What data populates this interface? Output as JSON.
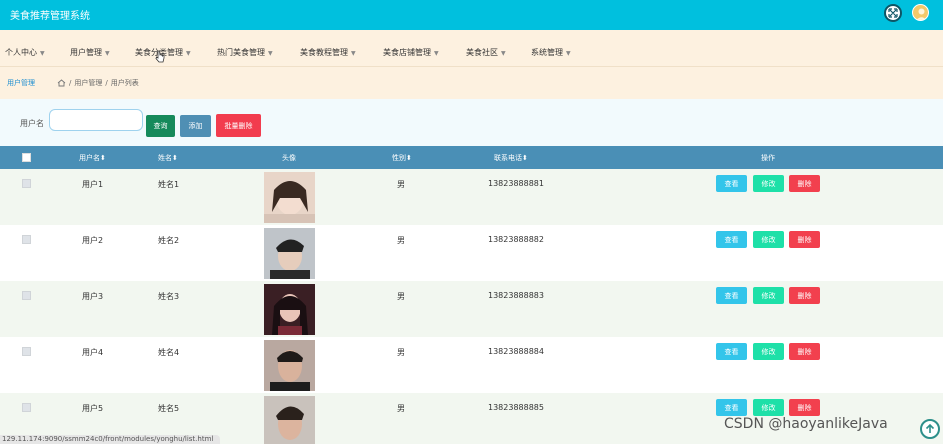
{
  "app": {
    "title": "美食推荐管理系统"
  },
  "header": {
    "fullscreen_icon": "expand-icon",
    "avatar_icon": "user-avatar-icon"
  },
  "menu": [
    {
      "label": "个人中心"
    },
    {
      "label": "用户管理"
    },
    {
      "label": "美食分类管理"
    },
    {
      "label": "热门美食管理"
    },
    {
      "label": "美食教程管理"
    },
    {
      "label": "美食店铺管理"
    },
    {
      "label": "美食社区"
    },
    {
      "label": "系统管理"
    }
  ],
  "breadcrumb": {
    "title": "用户管理",
    "trail": [
      "用户管理",
      "用户列表"
    ]
  },
  "search": {
    "label": "用户名",
    "value": "",
    "placeholder": "",
    "search_button": "查询",
    "add_button": "添加",
    "batch_delete_button": "批量删除"
  },
  "table": {
    "headers": {
      "username": "用户名",
      "name": "姓名",
      "avatar": "头像",
      "gender": "性别",
      "phone": "联系电话",
      "actions": "操作"
    },
    "sort_glyph": "⬍",
    "rows": [
      {
        "username": "用户1",
        "name": "姓名1",
        "gender": "男",
        "phone": "13823888881"
      },
      {
        "username": "用户2",
        "name": "姓名2",
        "gender": "男",
        "phone": "13823888882"
      },
      {
        "username": "用户3",
        "name": "姓名3",
        "gender": "男",
        "phone": "13823888883"
      },
      {
        "username": "用户4",
        "name": "姓名4",
        "gender": "男",
        "phone": "13823888884"
      },
      {
        "username": "用户5",
        "name": "姓名5",
        "gender": "男",
        "phone": "13823888885"
      }
    ],
    "view_label": "查看",
    "edit_label": "修改",
    "delete_label": "删除"
  },
  "status_url": "129.11.174:9090/ssmm24c0/front/modules/yonghu/list.html",
  "watermark": "CSDN @haoyanlikeJava",
  "colors": {
    "header": "#00c0de",
    "menubar": "#fdf1e0",
    "table_head": "#4a8fb6",
    "view": "#33c5ea",
    "edit": "#1ee0a8",
    "delete": "#f2404e"
  }
}
